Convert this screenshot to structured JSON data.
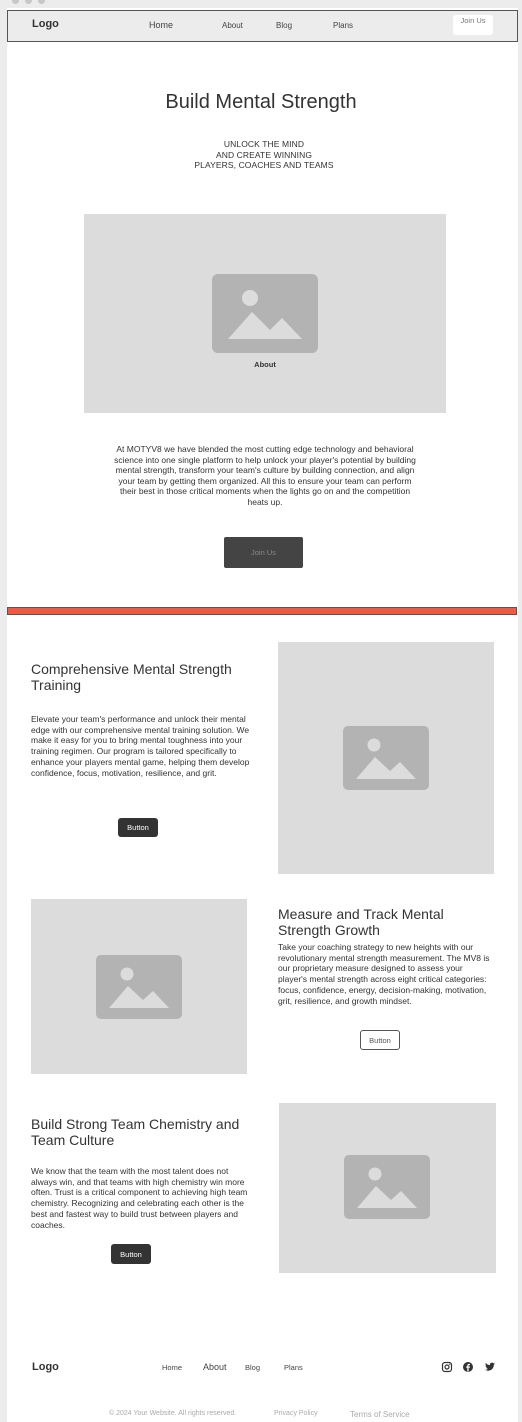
{
  "nav": {
    "logo": "Logo",
    "links": [
      "Home",
      "About",
      "Blog",
      "Plans"
    ],
    "join": "Join Us"
  },
  "hero": {
    "title": "Build Mental Strength",
    "subtitle_lines": [
      "UNLOCK THE MIND",
      "AND CREATE WINNING",
      "PLAYERS, COACHES AND TEAMS"
    ],
    "image_caption": "About",
    "about_text": "At MOTYV8 we have blended the most cutting edge technology and behavioral science into one single platform to help unlock your player's potential by building mental strength, transform your team's culture by building connection, and align your team by getting them organized. All this to ensure your team can perform their best in those critical moments when the lights go on and the competition heats up.",
    "join_button": "Join Us"
  },
  "accent_color": "#ee5a45",
  "features": [
    {
      "title": "Comprehensive Mental Strength Training",
      "body": "Elevate your team's performance and unlock their mental edge with our comprehensive mental training solution. We make it easy for you to bring mental toughness into your training regimen. Our program is tailored specifically to enhance your players mental game, helping them develop confidence, focus, motivation, resilience, and grit.",
      "button": "Button"
    },
    {
      "title": "Measure and Track Mental Strength Growth",
      "body": "Take your coaching strategy to new heights with our revolutionary mental strength measurement. The MV8 is our proprietary measure designed to assess your player's mental strength across eight critical categories: focus, confidence, energy, decision-making, motivation, grit, resilience, and growth mindset.",
      "button": "Button"
    },
    {
      "title": "Build Strong Team Chemistry and Team Culture",
      "body": "We know that the team with the most talent does not always win, and that teams with high chemistry win more often. Trust is a critical component to achieving high team chemistry. Recognizing and celebrating each other is the best and fastest way to build trust between players and coaches.",
      "button": "Button"
    }
  ],
  "footer": {
    "logo": "Logo",
    "links": [
      "Home",
      "About",
      "Blog",
      "Plans"
    ],
    "social_icons": [
      "instagram-icon",
      "facebook-icon",
      "twitter-icon"
    ],
    "copyright": "© 2024 Your Website. All rights reserved.",
    "privacy": "Privacy Policy",
    "terms": "Terms of Service"
  }
}
